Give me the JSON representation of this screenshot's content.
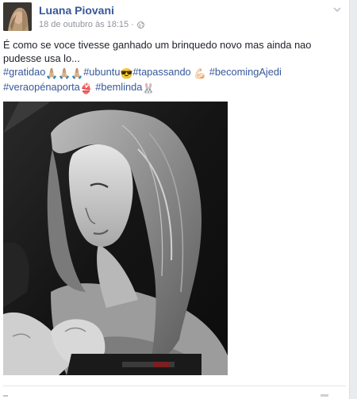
{
  "post": {
    "author": "Luana Piovani",
    "timestamp": "18 de outubro às 18:15",
    "separator": "·",
    "audience_icon": "globe-icon",
    "options_icon": "chevron-down-icon",
    "text_line": "É como se voce tivesse ganhado um brinquedo novo mas ainda nao pudesse usa lo...",
    "hashtags": {
      "gratidao": "#gratidao",
      "ubuntu": "#ubuntu",
      "tapassando": "#tapassando",
      "becoming": "#becomingAjedi",
      "verao": "#veraopénaporta",
      "bemlinda": "#bemlinda"
    },
    "emojis": {
      "prayer": "🙏🏼🙏🏼🙏🏼",
      "sunglasses": "😎",
      "flex": "💪🏻",
      "bikini": "👙",
      "bunny": "🐰"
    }
  },
  "colors": {
    "link": "#365899",
    "text": "#1d2129",
    "meta": "#90949c",
    "gutter": "#e9ebee"
  }
}
